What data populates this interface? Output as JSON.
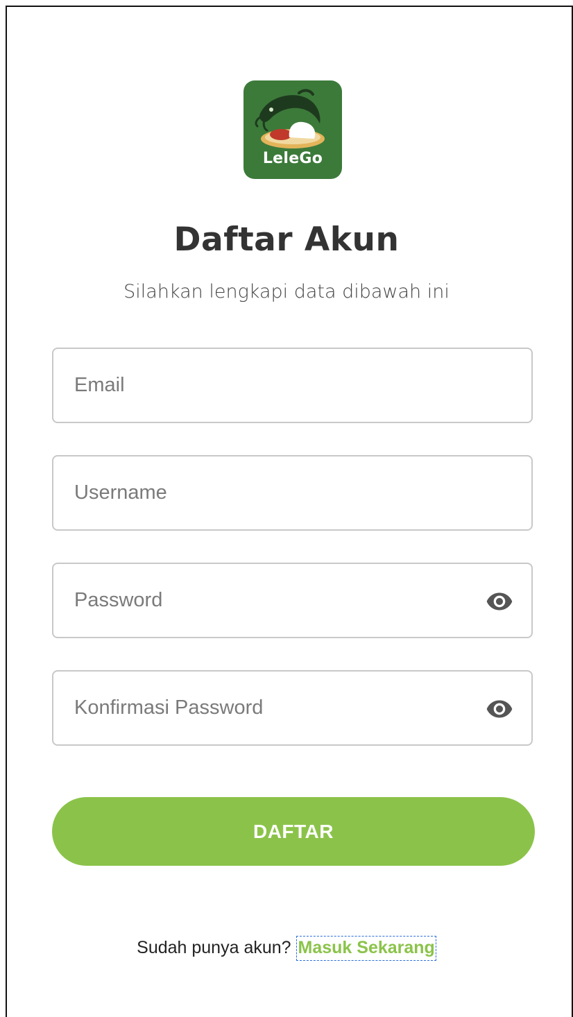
{
  "logo": {
    "text": "LeleGo",
    "bg_color": "#3c7a3a"
  },
  "header": {
    "title": "Daftar Akun",
    "subtitle": "Silahkan lengkapi data dibawah ini"
  },
  "form": {
    "email": {
      "placeholder": "Email",
      "value": ""
    },
    "username": {
      "placeholder": "Username",
      "value": ""
    },
    "password": {
      "placeholder": "Password",
      "value": "",
      "icon": "eye-icon"
    },
    "confirm_password": {
      "placeholder": "Konfirmasi Password",
      "value": "",
      "icon": "eye-icon"
    },
    "submit_label": "DAFTAR"
  },
  "footer": {
    "prompt": "Sudah punya akun?",
    "link_label": "Masuk Sekarang"
  },
  "colors": {
    "accent": "#8bc34a",
    "text": "#333333",
    "border": "#c8c8c8"
  }
}
